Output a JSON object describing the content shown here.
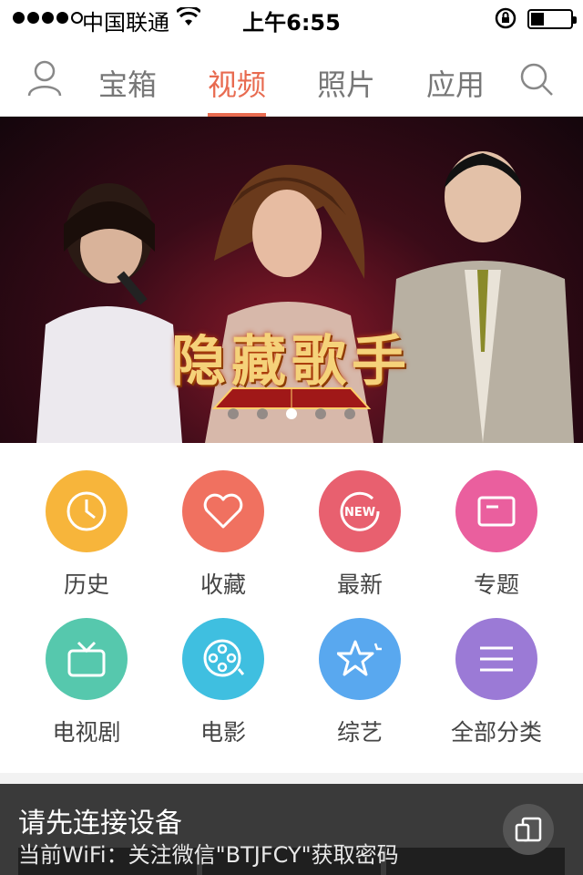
{
  "status_bar": {
    "carrier": "中国联通",
    "time": "上午6:55"
  },
  "nav": {
    "tabs": [
      {
        "label": "宝箱"
      },
      {
        "label": "视频"
      },
      {
        "label": "照片"
      },
      {
        "label": "应用"
      }
    ],
    "active_tab": "视频",
    "accent_color": "#e86b50"
  },
  "banner": {
    "title": "隐藏歌手",
    "slide_count": 5,
    "active_slide": 3
  },
  "categories": [
    {
      "label": "历史",
      "icon": "clock-icon",
      "color": "#f7b53b"
    },
    {
      "label": "收藏",
      "icon": "heart-icon",
      "color": "#f07160"
    },
    {
      "label": "最新",
      "icon": "new-icon",
      "color": "#e8606f"
    },
    {
      "label": "专题",
      "icon": "topic-icon",
      "color": "#ea5f9e"
    },
    {
      "label": "电视剧",
      "icon": "tv-icon",
      "color": "#56c8ad"
    },
    {
      "label": "电影",
      "icon": "film-reel-icon",
      "color": "#3fbfe0"
    },
    {
      "label": "综艺",
      "icon": "stars-icon",
      "color": "#59a8ef"
    },
    {
      "label": "全部分类",
      "icon": "menu-icon",
      "color": "#9b7ad6"
    }
  ],
  "connect_prompt": {
    "title": "请先连接设备",
    "subtitle": "当前WiFi：关注微信\"BTJFCY\"获取密码"
  }
}
